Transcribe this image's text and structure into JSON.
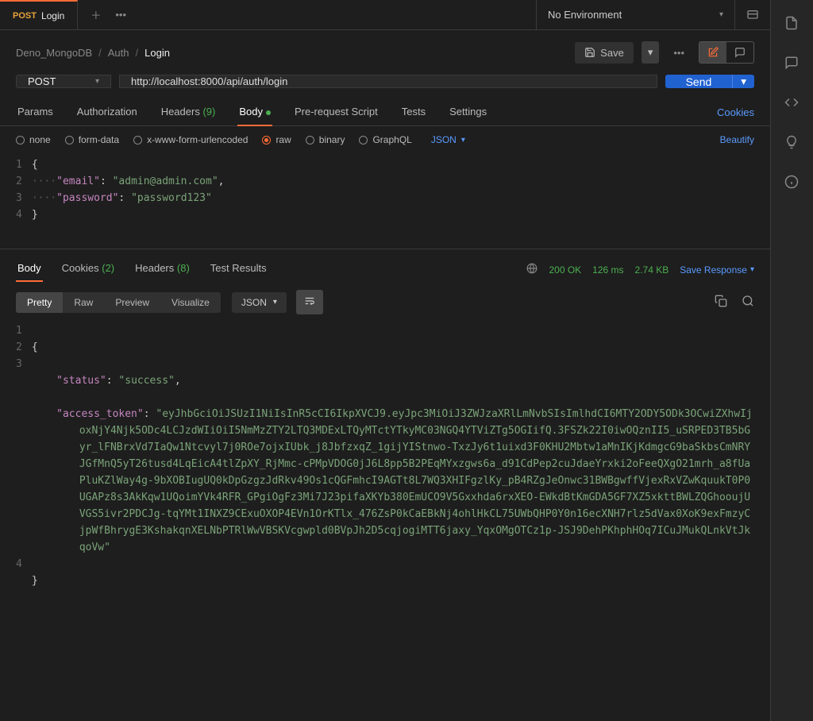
{
  "tab": {
    "method": "POST",
    "title": "Login"
  },
  "environment": {
    "label": "No Environment"
  },
  "breadcrumb": {
    "root": "Deno_MongoDB",
    "folder": "Auth",
    "name": "Login"
  },
  "toolbar": {
    "save": "Save"
  },
  "request": {
    "method": "POST",
    "url": "http://localhost:8000/api/auth/login",
    "send": "Send"
  },
  "reqTabs": {
    "params": "Params",
    "authorization": "Authorization",
    "headers": "Headers",
    "headersCount": "(9)",
    "body": "Body",
    "prerequest": "Pre-request Script",
    "tests": "Tests",
    "settings": "Settings",
    "cookies": "Cookies"
  },
  "bodyTypes": {
    "none": "none",
    "formData": "form-data",
    "urlencoded": "x-www-form-urlencoded",
    "raw": "raw",
    "binary": "binary",
    "graphql": "GraphQL",
    "format": "JSON",
    "beautify": "Beautify"
  },
  "requestBody": {
    "emailKey": "\"email\"",
    "emailVal": "\"admin@admin.com\"",
    "passwordKey": "\"password\"",
    "passwordVal": "\"password123\""
  },
  "respTabs": {
    "body": "Body",
    "cookies": "Cookies",
    "cookiesCount": "(2)",
    "headers": "Headers",
    "headersCount": "(8)",
    "testResults": "Test Results"
  },
  "respMeta": {
    "status": "200 OK",
    "time": "126 ms",
    "size": "2.74 KB",
    "saveResponse": "Save Response"
  },
  "viewModes": {
    "pretty": "Pretty",
    "raw": "Raw",
    "preview": "Preview",
    "visualize": "Visualize",
    "format": "JSON"
  },
  "responseBody": {
    "statusKey": "\"status\"",
    "statusVal": "\"success\"",
    "tokenKey": "\"access_token\"",
    "tokenVal": "\"eyJhbGciOiJSUzI1NiIsInR5cCI6IkpXVCJ9.eyJpc3MiOiJ3ZWJzaXRlLmNvbSIsImlhdCI6MTY2ODY5ODk3OCwiZXhwIjoxNjY4Njk5ODc4LCJzdWIiOiI5NmMzZTY2LTQ3MDExLTQyMTctYTkyMC03NGQ4YTViZTg5OGIifQ.3FSZk22I0iwOQznII5_uSRPED3TB5bGyr_lFNBrxVd7IaQw1Ntcvyl7j0ROe7ojxIUbk_j8JbfzxqZ_1gijYIStnwo-TxzJy6t1uixd3F0KHU2Mbtw1aMnIKjKdmgcG9baSkbsCmNRYJGfMnQ5yT26tusd4LqEicA4tlZpXY_RjMmc-cPMpVDOG0jJ6L8pp5B2PEqMYxzgws6a_d91CdPep2cuJdaeYrxki2oFeeQXgO21mrh_a8fUaPluKZlWay4g-9bXOBIugUQ0kDpGzgzJdRkv49Os1cQGFmhcI9AGTt8L7WQ3XHIFgzlKy_pB4RZgJeOnwc31BWBgwffVjexRxVZwKquukT0P0UGAPz8s3AkKqw1UQoimYVk4RFR_GPgiOgFz3Mi7J23pifaXKYb380EmUCO9V5Gxxhda6rxXEO-EWkdBtKmGDA5GF7XZ5xkttBWLZQGhooujUVGS5ivr2PDCJg-tqYMt1INXZ9CExuOXOP4EVn1OrKTlx_476ZsP0kCaEBkNj4ohlHkCL75UWbQHP0Y0n16ecXNH7rlz5dVax0XoK9exFmzyCjpWfBhrygE3KshakqnXELNbPTRlWwVBSKVcgwpld0BVpJh2D5cqjogiMTT6jaxy_YqxOMgOTCz1p-JSJ9DehPKhphHOq7ICuJMukQLnkVtJkqoVw\""
  }
}
